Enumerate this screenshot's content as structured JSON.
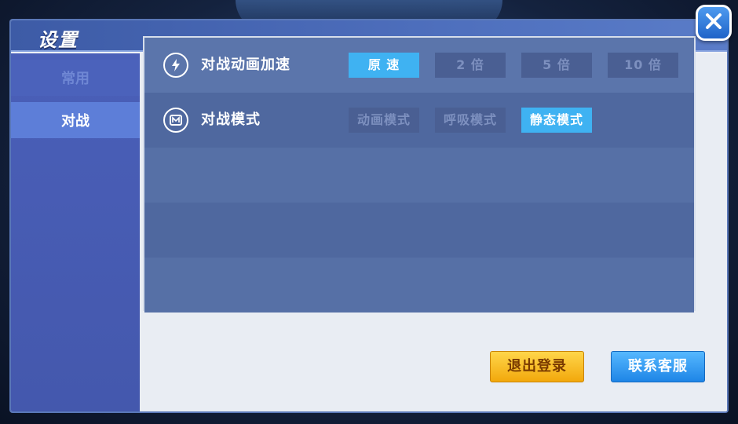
{
  "window": {
    "title": "设置"
  },
  "sidebar": {
    "items": [
      {
        "label": "常用",
        "active": false
      },
      {
        "label": "对战",
        "active": true
      }
    ]
  },
  "settings": {
    "battle_speed": {
      "icon": "lightning-icon",
      "label": "对战动画加速",
      "options": [
        "原 速",
        "2 倍",
        "5 倍",
        "10 倍"
      ],
      "selected": "原 速"
    },
    "battle_mode": {
      "icon": "mode-icon",
      "label": "对战模式",
      "options": [
        "动画模式",
        "呼吸模式",
        "静态模式"
      ],
      "selected": "静态模式"
    }
  },
  "footer": {
    "logout_label": "退出登录",
    "support_label": "联系客服"
  },
  "colors": {
    "selected_option": "#3fb2f2",
    "logout_button": "#f2a80c",
    "support_button": "#1e85e6"
  },
  "close": {
    "icon": "close-icon"
  }
}
